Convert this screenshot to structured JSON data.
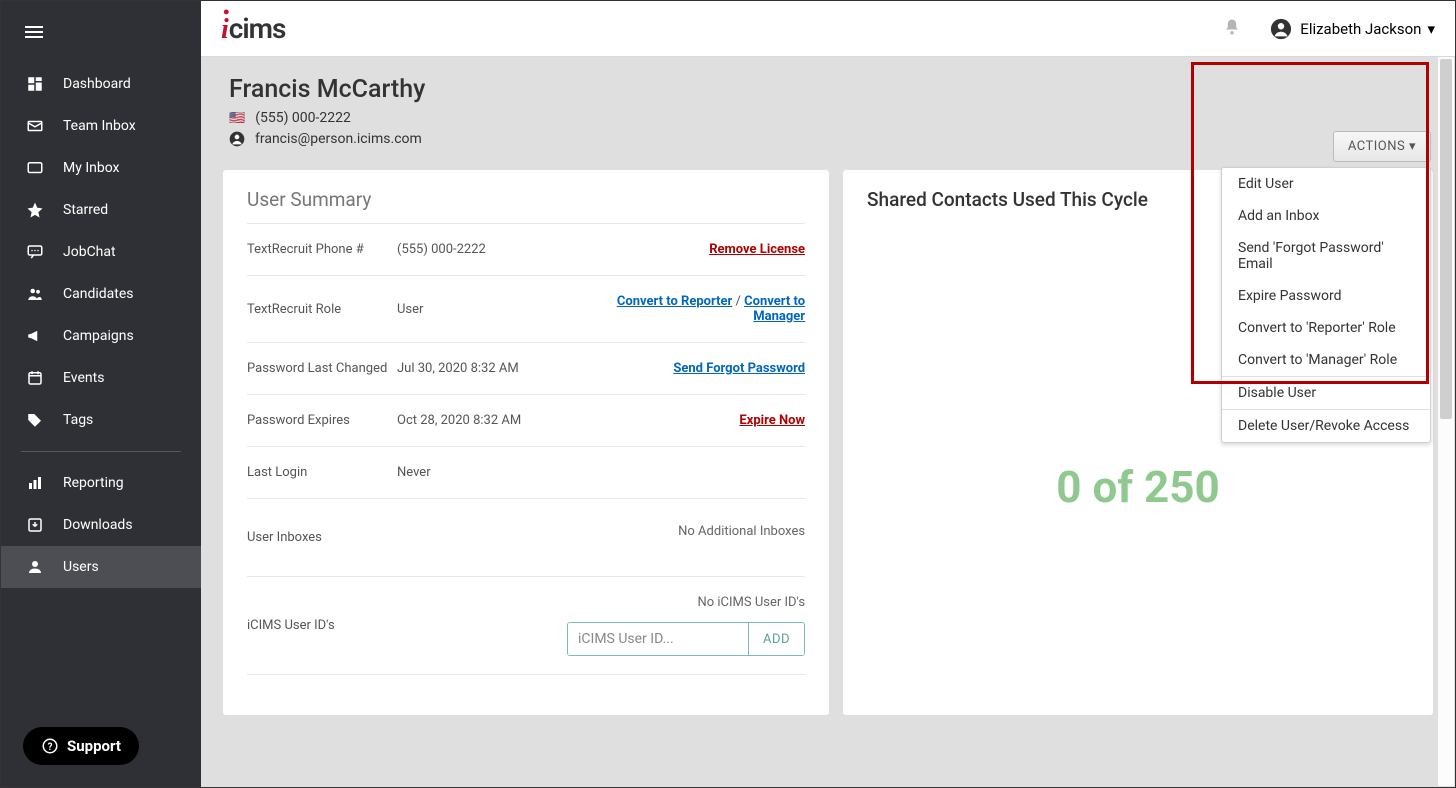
{
  "logo": "cims",
  "header_user": "Elizabeth Jackson",
  "nav": [
    {
      "label": "Dashboard",
      "icon": "dashboard-icon"
    },
    {
      "label": "Team Inbox",
      "icon": "team-inbox-icon"
    },
    {
      "label": "My Inbox",
      "icon": "my-inbox-icon"
    },
    {
      "label": "Starred",
      "icon": "star-icon"
    },
    {
      "label": "JobChat",
      "icon": "chat-icon"
    },
    {
      "label": "Candidates",
      "icon": "candidates-icon"
    },
    {
      "label": "Campaigns",
      "icon": "campaigns-icon"
    },
    {
      "label": "Events",
      "icon": "events-icon"
    },
    {
      "label": "Tags",
      "icon": "tags-icon"
    }
  ],
  "nav2": [
    {
      "label": "Reporting",
      "icon": "reporting-icon"
    },
    {
      "label": "Downloads",
      "icon": "downloads-icon"
    },
    {
      "label": "Users",
      "icon": "users-icon"
    }
  ],
  "support_label": "Support",
  "user": {
    "name": "Francis McCarthy",
    "phone": "(555) 000-2222",
    "email": "francis@person.icims.com"
  },
  "actions_button": "ACTIONS",
  "actions_menu": [
    "Edit User",
    "Add an Inbox",
    "Send 'Forgot Password' Email",
    "Expire Password",
    "Convert to 'Reporter' Role",
    "Convert to 'Manager' Role"
  ],
  "actions_menu2": [
    "Disable User"
  ],
  "actions_menu3": [
    "Delete User/Revoke Access"
  ],
  "summary": {
    "title": "User Summary",
    "rows": [
      {
        "label": "TextRecruit Phone #",
        "value": "(555) 000-2222",
        "action_type": "red",
        "action": "Remove License"
      },
      {
        "label": "TextRecruit Role",
        "value": "User",
        "action_type": "dual",
        "action_a": "Convert to Reporter",
        "slash": " / ",
        "action_b": "Convert to Manager"
      },
      {
        "label": "Password Last Changed",
        "value": "Jul 30, 2020 8:32 AM",
        "action_type": "blue",
        "action": "Send Forgot Password"
      },
      {
        "label": "Password Expires",
        "value": "Oct 28, 2020 8:32 AM",
        "action_type": "red",
        "action": "Expire Now"
      },
      {
        "label": "Last Login",
        "value": "Never"
      }
    ],
    "inboxes_label": "User Inboxes",
    "inboxes_empty": "No Additional Inboxes",
    "ids_label": "iCIMS User ID's",
    "ids_empty": "No iCIMS User ID's",
    "id_placeholder": "iCIMS User ID...",
    "add_label": "ADD"
  },
  "shared": {
    "title": "Shared Contacts Used This Cycle",
    "value": "0 of 250"
  }
}
